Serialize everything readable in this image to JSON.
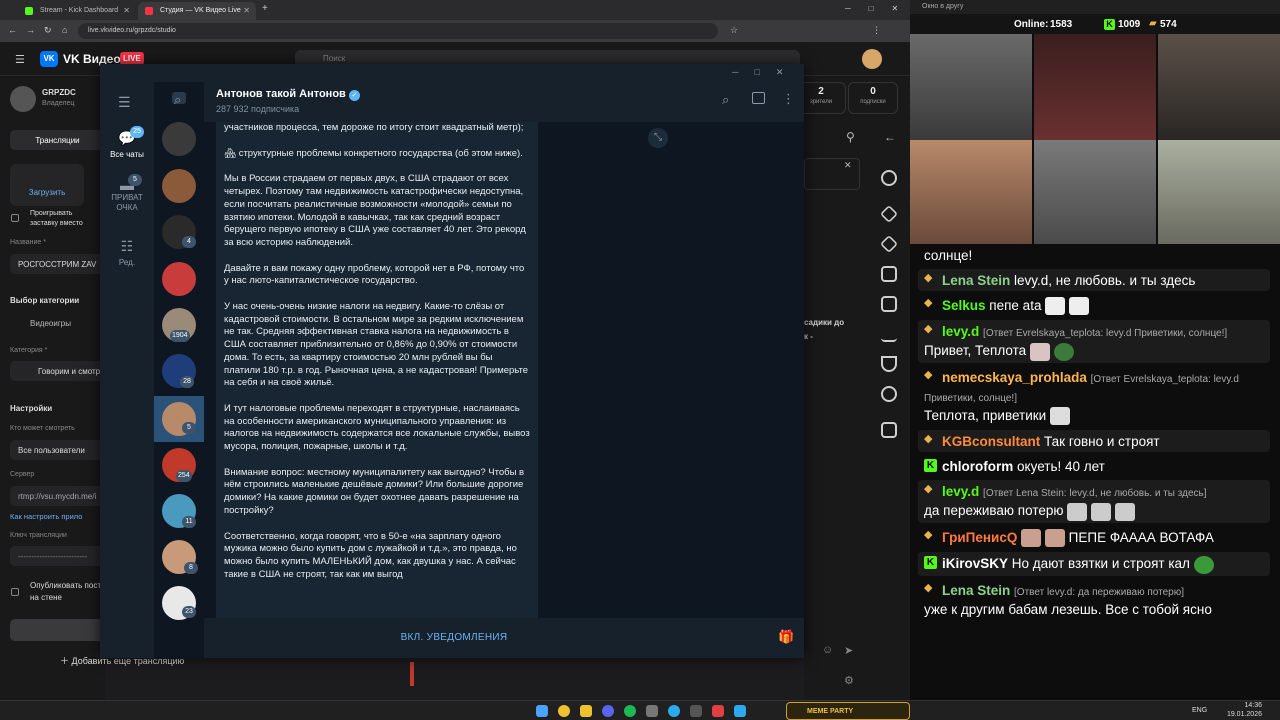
{
  "browser": {
    "tabs": [
      {
        "label": "Stream - Kick Dashboard",
        "color": "#53fc18"
      },
      {
        "label": "Студия — VK Видео Live",
        "color": "#ff3347"
      }
    ],
    "new_tab": "+",
    "url": "live.vkvideo.ru/grpzdc/studio"
  },
  "vk": {
    "logo_text": "VK Видео",
    "live_badge": "LIVE",
    "search_placeholder": "Поиск",
    "channel_name": "GRPZDC",
    "channel_role": "Владелец",
    "tab_streams": "Трансляции",
    "upload_label": "Загрузить",
    "play_ad_label": "Проигрывать заставку вместо обложки",
    "title_label": "Название *",
    "title_value": "РОСГОССТРИМ ZAV",
    "category_choice_label": "Выбор категории",
    "videogames_label": "Видеоигры",
    "category_label": "Категория *",
    "category_value": "Говорим и смотрим",
    "settings_label": "Настройки",
    "who_can_watch_label": "Кто может смотреть",
    "who_can_watch_value": "Все пользователи",
    "server_label": "Сервер",
    "server_value": "rtmp://vsu.mycdn.me/i",
    "how_to_link": "Как настроить прило",
    "key_label": "Ключ трансляции",
    "key_value": "--------------------------",
    "publish_label": "Опубликовать пост на стене сообщества",
    "add_stream_label": "Добавить еще трансляцию",
    "stats": [
      {
        "value": "2",
        "label": "зрители"
      },
      {
        "value": "0",
        "label": "подписки"
      }
    ],
    "right_text": [
      "садики до",
      "к -"
    ]
  },
  "telegram": {
    "folders": [
      {
        "label": "Все чаты",
        "badge": "25"
      },
      {
        "label": "ПРИВАТОЧКА",
        "badge": "5"
      },
      {
        "label": "Ред."
      }
    ],
    "chat_badges": [
      "4",
      "1904",
      "28",
      "5",
      "254",
      "11",
      "8",
      "23"
    ],
    "channel_title": "Антонов такой Антонов",
    "subscribers": "287 932 подписчика",
    "paragraphs": [
      "участников процесса, тем дороже по итогу стоит квадратный метр);",
      "структурные проблемы конкретного государства (об этом ниже).",
      "Мы в России страдаем от первых двух, в США страдают от всех четырех. Поэтому там недвижимость катастрофически недоступна, если посчитать реалистичные возможности «молодой» семьи по взятию ипотеки. Молодой в кавычках, так как средний возраст берущего первую ипотеку в США уже составляет 40 лет. Это рекорд за всю историю наблюдений.",
      "Давайте я вам покажу одну проблему, которой нет в РФ, потому что у нас люто-капиталистическое государство.",
      "У нас очень-очень низкие налоги на недвигу. Какие-то слёзы от кадастровой стоимости. В остальном мире за редким исключением не так. Средняя эффективная ставка налога на недвижимость в США составляет приблизительно от 0,86% до 0,90% от стоимости дома. То есть, за квартиру стоимостью 20 млн рублей вы бы платили 180 т.р. в год. Рыночная цена, а не кадастровая! Примерьте на себя и на своё жильё.",
      "И тут налоговые проблемы переходят в структурные, наслаиваясь на особенности американского муниципального управления: из налогов на недвижимость содержатся все локальные службы, вывоз мусора, полиция, пожарные, школы и т.д.",
      "Внимание вопрос: местному муниципалитету как выгодно? Чтобы в нём строились маленькие дешёвые домики? Или большие дорогие домики? На какие домики он будет охотнее давать разрешение на постройку?",
      "Соответственно, когда говорят, что в 50-е «на зарплату одного мужика можно было купить дом с лужайкой и т.д.», это правда, но можно было купить МАЛЕНЬКИЙ дом, как двушка у нас. А сейчас такие в США не строят, так как им выгод"
    ],
    "unread_badge": "5",
    "notify_button": "ВКЛ. УВЕДОМЛЕНИЯ"
  },
  "stream": {
    "window_title": "Окно в другу",
    "online_label": "Online:",
    "online_value": "1583",
    "kick_value": "1009",
    "gold_value": "574",
    "chat": [
      {
        "type": "plain",
        "text": "солнце!"
      },
      {
        "badge": "gold",
        "user": "Lena Stein",
        "color": "#8cd28c",
        "text": "levy.d, не любовь. и ты здесь"
      },
      {
        "badge": "gold",
        "user": "Selkus",
        "color": "#53fc18",
        "text": "пепе ata"
      },
      {
        "badge": "gold",
        "user": "levy.d",
        "color": "#53fc18",
        "reply": "[Ответ Evrelskaya_teplota: levy.d Приветики, солнце!]",
        "text": "Привет, Теплота"
      },
      {
        "badge": "gold",
        "user": "nemecskaya_prohlada",
        "color": "#ffb64d",
        "reply": "[Ответ Evrelskaya_teplota: levy.d Приветики, солнце!]",
        "text": "Теплота, приветики"
      },
      {
        "badge": "gold",
        "user": "KGBconsultant",
        "color": "#ff8a3c",
        "text": "Так говно и строят"
      },
      {
        "badge": "kick",
        "user": "chloroform",
        "color": "#ffffff",
        "text": "окуеть! 40 лет"
      },
      {
        "badge": "gold",
        "user": "levy.d",
        "color": "#53fc18",
        "reply": "[Ответ Lena Stein: levy.d, не любовь. и ты здесь]",
        "text": "да переживаю потерю"
      },
      {
        "badge": "gold",
        "user": "ГриПенисQ",
        "color": "#ff7a3c",
        "text": "ПЕПЕ ФАААА ВОТАФА"
      },
      {
        "badge": "kick",
        "user": "iKirovSKY",
        "color": "#ffffff",
        "text": "Но дают взятки и строят кал"
      },
      {
        "badge": "gold",
        "user": "Lena Stein",
        "color": "#8cd28c",
        "reply": "[Ответ levy.d: да переживаю потерю]",
        "text": "уже к другим бабам лезешь. Все с тобой ясно"
      }
    ]
  },
  "taskbar": {
    "lang": "ENG",
    "time": "14:36",
    "date": "19.01.2026",
    "meme_label": "MEME PARTY"
  }
}
